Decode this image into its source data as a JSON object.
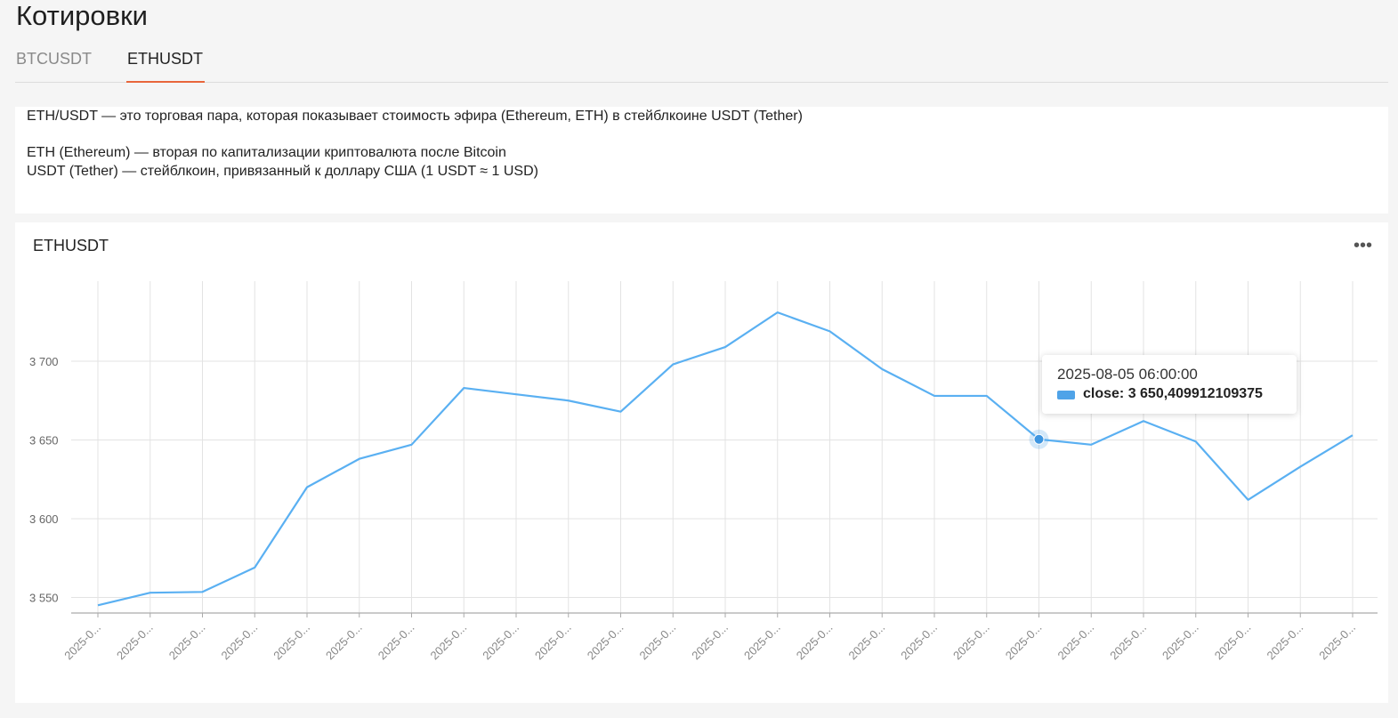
{
  "page": {
    "title": "Котировки"
  },
  "tabs": [
    {
      "label": "BTCUSDT",
      "active": false
    },
    {
      "label": "ETHUSDT",
      "active": true
    }
  ],
  "description": {
    "line1": "ETH/USDT — это торговая пара, которая показывает стоимость эфира (Ethereum, ETH) в стейблкоине USDT (Tether)",
    "line2": "ETH (Ethereum) — вторая по капитализации криптовалюта после Bitcoin",
    "line3": "USDT (Tether) — стейблкоин, привязанный к доллару США (1 USDT ≈ 1 USD)"
  },
  "chart_panel": {
    "title": "ETHUSDT",
    "menu_icon": "more-horizontal-icon"
  },
  "tooltip": {
    "title": "2025-08-05 06:00:00",
    "value_text": "close: 3 650,409912109375",
    "swatch_color": "#4fa3e8"
  },
  "chart_data": {
    "type": "line",
    "title": "ETHUSDT",
    "xlabel": "",
    "ylabel": "",
    "x_tick_label": "2025-0...",
    "series": [
      {
        "name": "close",
        "color": "#5ab0f2",
        "values": [
          3545,
          3553,
          3553.5,
          3569,
          3620,
          3638,
          3647,
          3683,
          3679,
          3675,
          3668,
          3698,
          3709,
          3731,
          3719,
          3695,
          3678,
          3678,
          3650.41,
          3647,
          3662,
          3649,
          3612,
          3633,
          3653
        ]
      }
    ],
    "ylim": [
      3540,
      3750
    ],
    "y_ticks": [
      3550,
      3600,
      3650,
      3700
    ],
    "y_tick_labels": [
      "3 550",
      "3 600",
      "3 650",
      "3 700"
    ],
    "highlight_index": 18,
    "grid": true
  }
}
